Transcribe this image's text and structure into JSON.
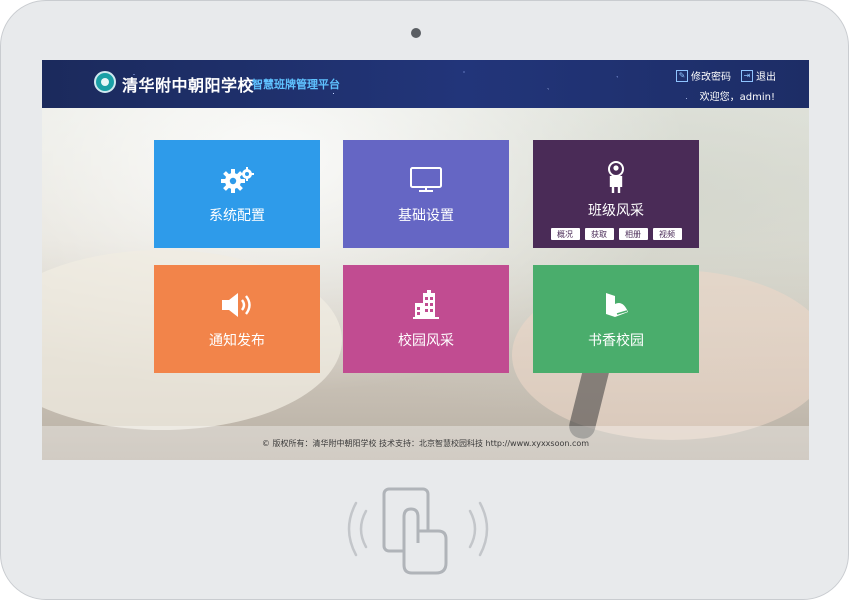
{
  "header": {
    "school_name": "清华附中朝阳学校",
    "platform_name": "智慧班牌管理平台",
    "change_password_label": "修改密码",
    "logout_label": "退出",
    "welcome_text": "欢迎您，admin!"
  },
  "tiles": [
    {
      "label": "系统配置",
      "color": "#2e9bea",
      "icon": "gears-icon"
    },
    {
      "label": "基础设置",
      "color": "#6566c4",
      "icon": "monitor-icon"
    },
    {
      "label": "班级风采",
      "color": "#4a2b57",
      "icon": "person-icon",
      "sub_buttons": [
        "概况",
        "获取",
        "相册",
        "视频"
      ]
    },
    {
      "label": "通知发布",
      "color": "#f2844a",
      "icon": "speaker-icon"
    },
    {
      "label": "校园风采",
      "color": "#c14c91",
      "icon": "building-icon"
    },
    {
      "label": "书香校园",
      "color": "#4aad6c",
      "icon": "book-icon"
    }
  ],
  "footer": {
    "text": "© 版权所有：清华附中朝阳学校  技术支持：北京智慧校园科技 http://www.xyxxsoon.com"
  },
  "colors": {
    "header_bg": "#1f3170",
    "device_frame": "#e8eaec"
  }
}
